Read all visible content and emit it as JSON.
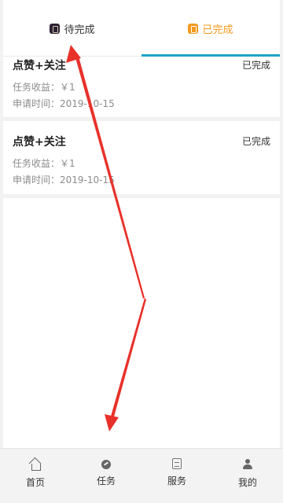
{
  "tabs": [
    {
      "label": "待完成",
      "icon": "pending-icon",
      "active": false
    },
    {
      "label": "已完成",
      "icon": "completed-icon",
      "active": true
    }
  ],
  "colors": {
    "accent_orange": "#f29a1f",
    "tab_underline": "#1fa3c7",
    "annotation_red": "#e8312a"
  },
  "tasks": [
    {
      "title": "点赞+关注",
      "status": "已完成",
      "reward": "任务收益：￥1",
      "apply_time": "申请时间：2019-10-15"
    },
    {
      "title": "点赞+关注",
      "status": "已完成",
      "reward": "任务收益：￥1",
      "apply_time": "申请时间：2019-10-15"
    }
  ],
  "bottom_nav": [
    {
      "label": "首页",
      "icon": "home-icon"
    },
    {
      "label": "任务",
      "icon": "task-icon"
    },
    {
      "label": "服务",
      "icon": "service-icon"
    },
    {
      "label": "我的",
      "icon": "profile-icon"
    }
  ]
}
